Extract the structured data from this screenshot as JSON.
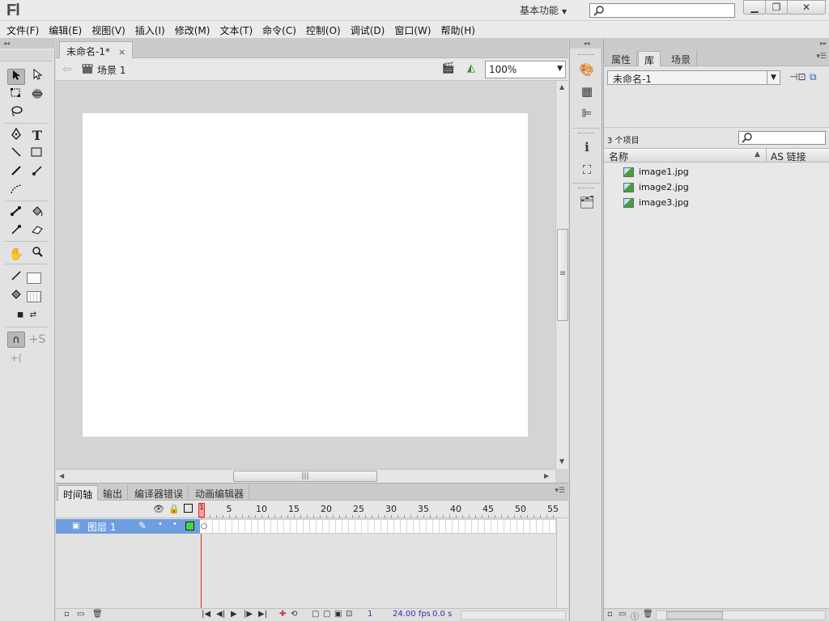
{
  "app": {
    "logo": "Fl",
    "workspace": "基本功能",
    "window_buttons": {
      "minimize": "▁",
      "maximize": "❐",
      "close": "✕"
    }
  },
  "menu": [
    "文件(F)",
    "编辑(E)",
    "视图(V)",
    "插入(I)",
    "修改(M)",
    "文本(T)",
    "命令(C)",
    "控制(O)",
    "调试(D)",
    "窗口(W)",
    "帮助(H)"
  ],
  "document": {
    "tab_title": "未命名-1*",
    "tab_close": "×",
    "scene": "场景 1",
    "zoom": "100%"
  },
  "timeline": {
    "tabs": [
      "时间轴",
      "输出",
      "编译器错误",
      "动画编辑器"
    ],
    "frame_numbers": [
      "5",
      "10",
      "15",
      "20",
      "25",
      "30",
      "35",
      "40",
      "45",
      "50",
      "55"
    ],
    "playhead_frame": "1",
    "layer_name": "图层 1",
    "current_frame": "1",
    "fps": "24.00 fps",
    "elapsed": "0.0 s"
  },
  "panel": {
    "tabs": [
      "属性",
      "库",
      "场景"
    ],
    "active_tab": "库",
    "library_document": "未命名-1",
    "item_count": "3 个项目",
    "col_name": "名称",
    "col_as": "AS 链接",
    "items": [
      "image1.jpg",
      "image2.jpg",
      "image3.jpg"
    ]
  },
  "icons": {
    "selection": "selection-tool-icon",
    "subselection": "subselection-tool-icon",
    "free_transform": "free-transform-icon",
    "3d_rotation": "3d-rotation-icon",
    "lasso": "lasso-icon",
    "pen": "pen-icon",
    "text": "text-tool-icon",
    "line": "line-tool-icon",
    "rectangle": "rectangle-tool-icon",
    "pencil": "pencil-icon",
    "brush": "brush-icon",
    "deco": "deco-tool-icon",
    "bone": "bone-tool-icon",
    "paint_bucket": "paint-bucket-icon",
    "eyedropper": "eyedropper-icon",
    "eraser": "eraser-icon",
    "hand": "hand-icon",
    "zoom": "zoom-icon"
  },
  "colors": {
    "accent_layer": "#6f9ee0",
    "playhead": "#d03030",
    "layer_outline": "#3ddc3d"
  }
}
